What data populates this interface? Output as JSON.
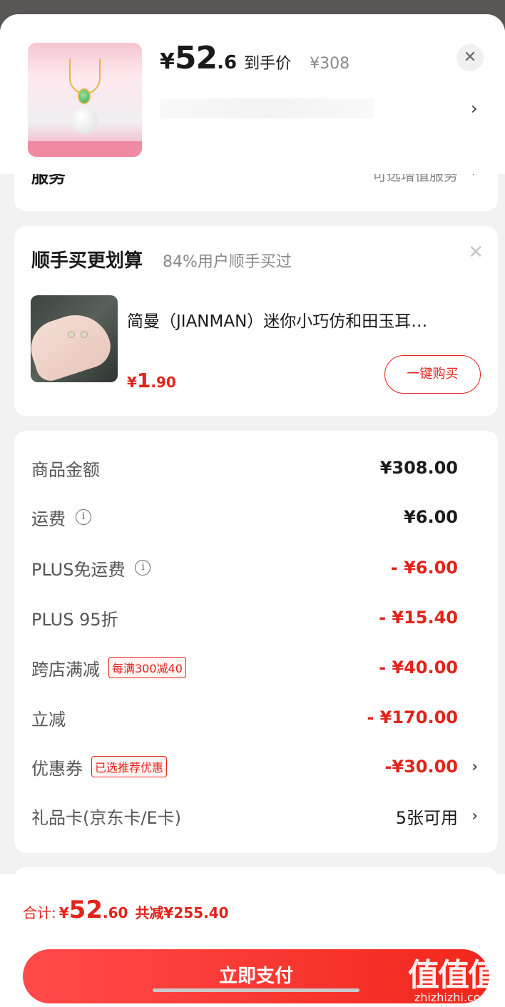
{
  "header": {
    "price_yen": "¥",
    "price_int": "52",
    "price_dec": ".6",
    "price_tag": "到手价",
    "original_price": "¥308",
    "close_icon": "close-icon",
    "chevron_icon": "chevron-right-icon"
  },
  "service": {
    "label": "服务",
    "value": "可选增值服务"
  },
  "bundle": {
    "title": "顺手买更划算",
    "subtitle": "84%用户顺手买过",
    "product_name": "简曼（JIANMAN）迷你小巧仿和田玉耳…",
    "price_yen": "¥",
    "price_int": "1",
    "price_dec": ".90",
    "buy_label": "一键购买"
  },
  "summary": {
    "rows": [
      {
        "label": "商品金额",
        "value": "¥308.00"
      },
      {
        "label": "运费",
        "value": "¥6.00"
      },
      {
        "label": "PLUS免运费",
        "value": "- ¥6.00"
      },
      {
        "label": "PLUS 95折",
        "value": "- ¥15.40"
      },
      {
        "label": "跨店满减",
        "badge": "每满300减40",
        "value": "- ¥40.00"
      },
      {
        "label": "立减",
        "value": "- ¥170.00"
      },
      {
        "label": "优惠券",
        "badge": "已选推荐优惠",
        "value": "-¥30.00"
      },
      {
        "label": "礼品卡(京东卡/E卡)",
        "value": "5张可用"
      }
    ]
  },
  "bottom": {
    "total_label": "合计:",
    "total_yen": "¥",
    "total_int": "52",
    "total_dec": ".60",
    "savings": "共减¥255.40",
    "pay_label": "立即支付"
  },
  "watermark": {
    "brand": "值值值",
    "domain": "zhizhizhi.com"
  },
  "colors": {
    "accent_red": "#e2231a",
    "pay_gradient_start": "#ff4b4b",
    "pay_gradient_end": "#f2271c"
  }
}
